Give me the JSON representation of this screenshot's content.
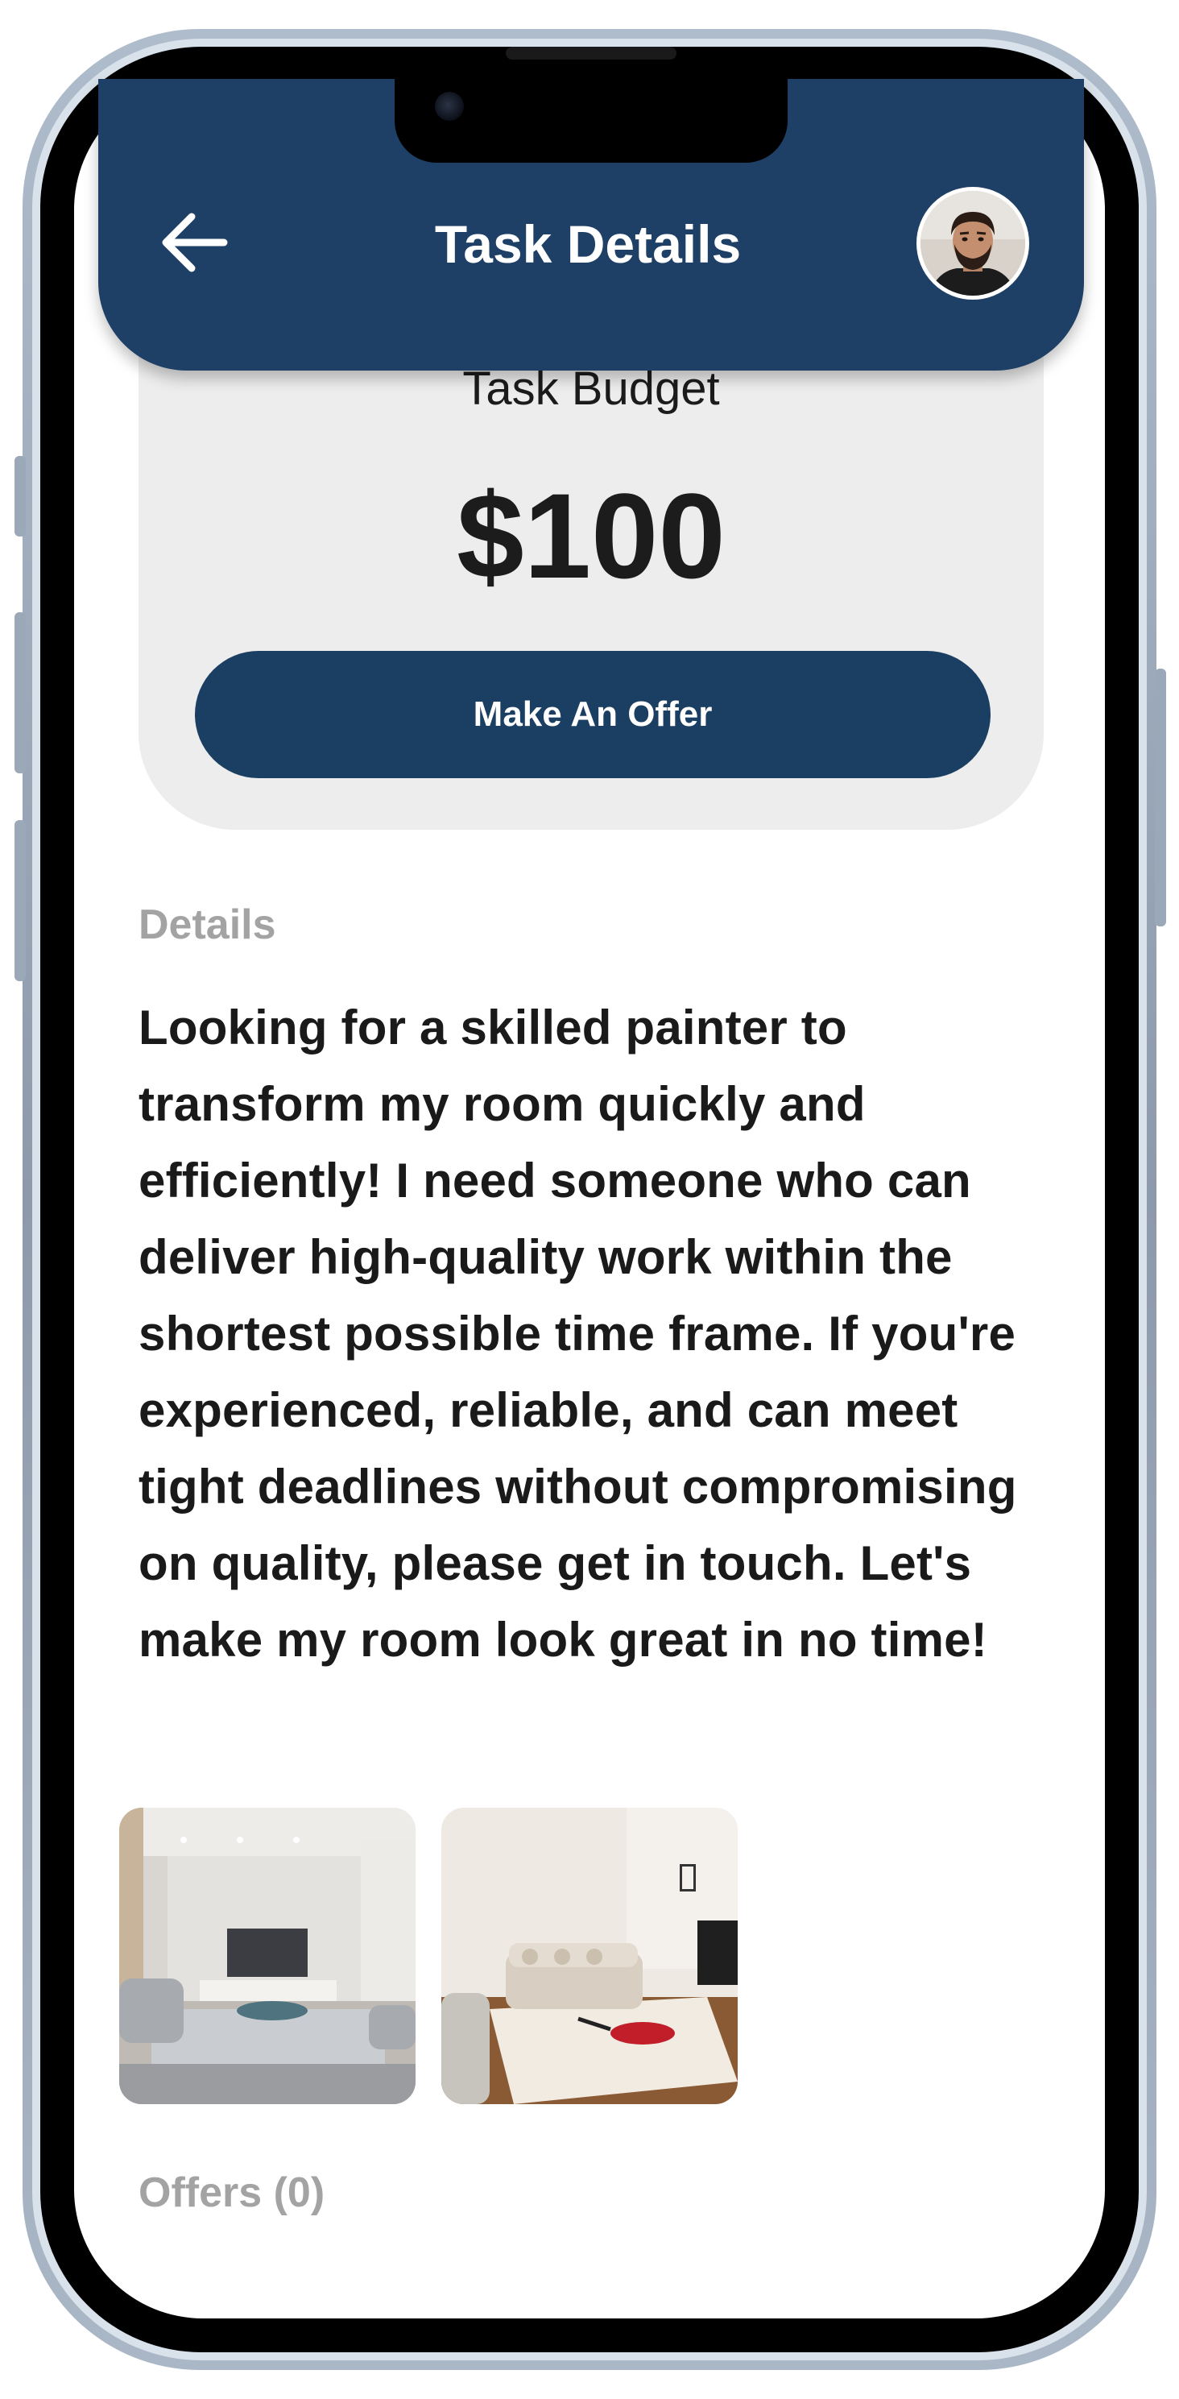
{
  "header": {
    "title": "Task Details",
    "back_icon": "arrow-left-icon",
    "bg_color": "#1e3f66"
  },
  "budget": {
    "label": "Task Budget",
    "value": "$100",
    "offer_button_label": "Make An Offer",
    "button_color": "#1b3f62"
  },
  "details": {
    "heading": "Details",
    "body": "Looking for a skilled painter to transform my room quickly and efficiently! I need someone who can deliver high-quality work within the shortest possible time frame. If you're experienced, reliable, and can meet tight deadlines without compromising on quality, please get in touch. Let's make my room look great in no time!"
  },
  "photos": [
    {
      "name": "living-room-photo-1"
    },
    {
      "name": "living-room-photo-2"
    }
  ],
  "offers": {
    "heading": "Offers (0)"
  }
}
